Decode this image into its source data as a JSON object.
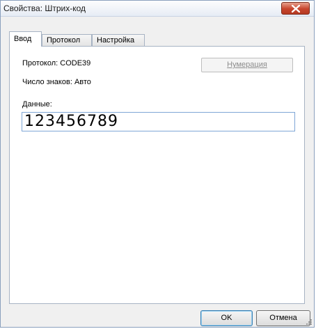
{
  "window": {
    "title": "Свойства: Штрих-код"
  },
  "tabs": [
    {
      "label": "Ввод",
      "active": true
    },
    {
      "label": "Протокол",
      "active": false
    },
    {
      "label": "Настройка",
      "active": false
    }
  ],
  "panel": {
    "protocol_label": "Протокол: CODE39",
    "char_count_label": "Число знаков: Авто",
    "numbering_button": "Нумерация",
    "data_label": "Данные:",
    "data_value": "123456789"
  },
  "footer": {
    "ok_label": "OK",
    "cancel_label": "Отмена"
  },
  "colors": {
    "close_button": "#c7442c",
    "field_border": "#7ea6d6"
  }
}
